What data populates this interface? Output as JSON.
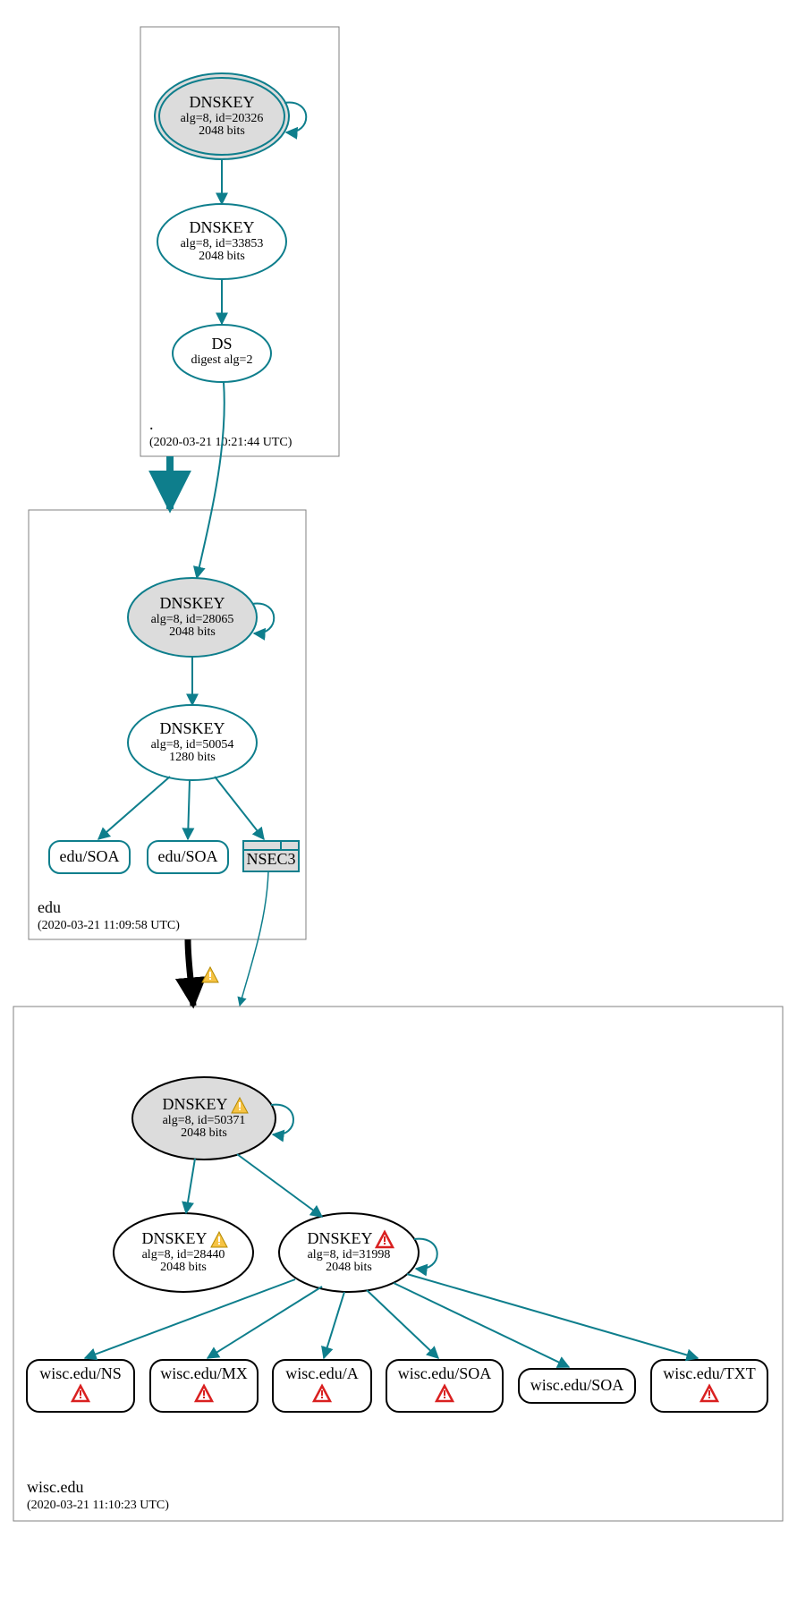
{
  "colors": {
    "teal": "#0E7E8C",
    "grey": "#dcdcdc",
    "black": "#000000",
    "white": "#ffffff"
  },
  "zones": {
    "root": {
      "name": ".",
      "timestamp": "(2020-03-21 10:21:44 UTC)",
      "nodes": {
        "ksk": {
          "title": "DNSKEY",
          "line1": "alg=8, id=20326",
          "line2": "2048 bits"
        },
        "zsk": {
          "title": "DNSKEY",
          "line1": "alg=8, id=33853",
          "line2": "2048 bits"
        },
        "ds": {
          "title": "DS",
          "line1": "digest alg=2"
        }
      }
    },
    "edu": {
      "name": "edu",
      "timestamp": "(2020-03-21 11:09:58 UTC)",
      "nodes": {
        "ksk": {
          "title": "DNSKEY",
          "line1": "alg=8, id=28065",
          "line2": "2048 bits"
        },
        "zsk": {
          "title": "DNSKEY",
          "line1": "alg=8, id=50054",
          "line2": "1280 bits"
        },
        "soa1": "edu/SOA",
        "soa2": "edu/SOA",
        "nsec3": "NSEC3"
      }
    },
    "wisc": {
      "name": "wisc.edu",
      "timestamp": "(2020-03-21 11:10:23 UTC)",
      "nodes": {
        "ksk": {
          "title": "DNSKEY",
          "line1": "alg=8, id=50371",
          "line2": "2048 bits"
        },
        "zsk1": {
          "title": "DNSKEY",
          "line1": "alg=8, id=28440",
          "line2": "2048 bits"
        },
        "zsk2": {
          "title": "DNSKEY",
          "line1": "alg=8, id=31998",
          "line2": "2048 bits"
        },
        "rr": {
          "ns": "wisc.edu/NS",
          "mx": "wisc.edu/MX",
          "a": "wisc.edu/A",
          "soa1": "wisc.edu/SOA",
          "soa2": "wisc.edu/SOA",
          "txt": "wisc.edu/TXT"
        }
      }
    }
  },
  "icons": {
    "warning": "warning-icon",
    "error": "error-icon"
  }
}
